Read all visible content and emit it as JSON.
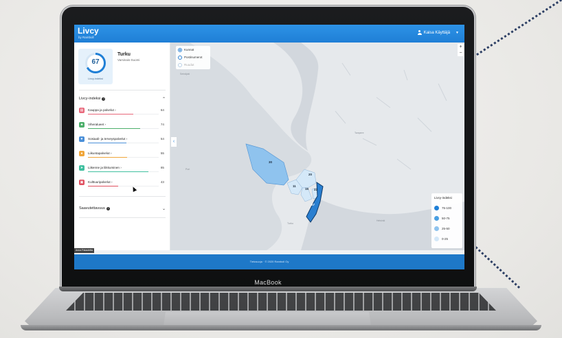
{
  "app": {
    "title": "Livcy",
    "subtitle": "by Ramboll",
    "user": "Kaisa Käyttäjä",
    "user_menu_icon": "caret-down-icon"
  },
  "laptop": {
    "brand": "MacBook"
  },
  "location": {
    "city": "Turku",
    "region": "Varsinais-Suomi"
  },
  "index_card": {
    "value": "67",
    "label": "Livcy-indeksi"
  },
  "index_section": {
    "title": "Livcy-indeksi",
    "items": [
      {
        "label": "Kauppa ja palvelut ›",
        "value": "64",
        "color": "#e8677a",
        "icon": "shop-icon",
        "level": 0.64
      },
      {
        "label": "Viheralueet ›",
        "value": "74",
        "color": "#4caf6a",
        "icon": "tree-icon",
        "level": 0.74
      },
      {
        "label": "Sosiaali- ja terveyspalvelut ›",
        "value": "54",
        "color": "#4a8fd8",
        "icon": "heart-icon",
        "level": 0.54
      },
      {
        "label": "Liikuntapalvelut ›",
        "value": "55",
        "color": "#f0a63a",
        "icon": "sport-icon",
        "level": 0.55
      },
      {
        "label": "Liikenne ja liikkuminen ›",
        "value": "85",
        "color": "#3fbf9f",
        "icon": "transit-icon",
        "level": 0.85
      },
      {
        "label": "Kulttuuripalvelut ›",
        "value": "43",
        "color": "#e04f5f",
        "icon": "culture-icon",
        "level": 0.43
      }
    ]
  },
  "accessibility_section": {
    "title": "Saavutettavuus"
  },
  "map": {
    "layers": [
      {
        "label": "Kunnat",
        "selected": true
      },
      {
        "label": "Postinumerot",
        "selected": false
      },
      {
        "label": "Ruudut",
        "selected": false,
        "disabled": true
      }
    ],
    "zoom_in": "+",
    "zoom_out": "−",
    "region_labels": [
      "30",
      "20",
      "11",
      "15",
      "22",
      "67"
    ],
    "places": [
      "Seinäjoki",
      "Tampere",
      "Pori",
      "Helsinki",
      "Turku"
    ],
    "legend": {
      "title": "Livcy-indeksi",
      "items": [
        {
          "label": "75-100",
          "color": "#1f7fd6"
        },
        {
          "label": "50-75",
          "color": "#4a9fe2"
        },
        {
          "label": "25-50",
          "color": "#8fc3ee"
        },
        {
          "label": "0-25",
          "color": "#d4e8f8"
        }
      ]
    }
  },
  "footer": {
    "text": "Tietosuoja · © 2020 Ramboll Oy"
  },
  "feedback": {
    "label": "Anna Palautetta"
  },
  "accent": "#1f7fd6"
}
